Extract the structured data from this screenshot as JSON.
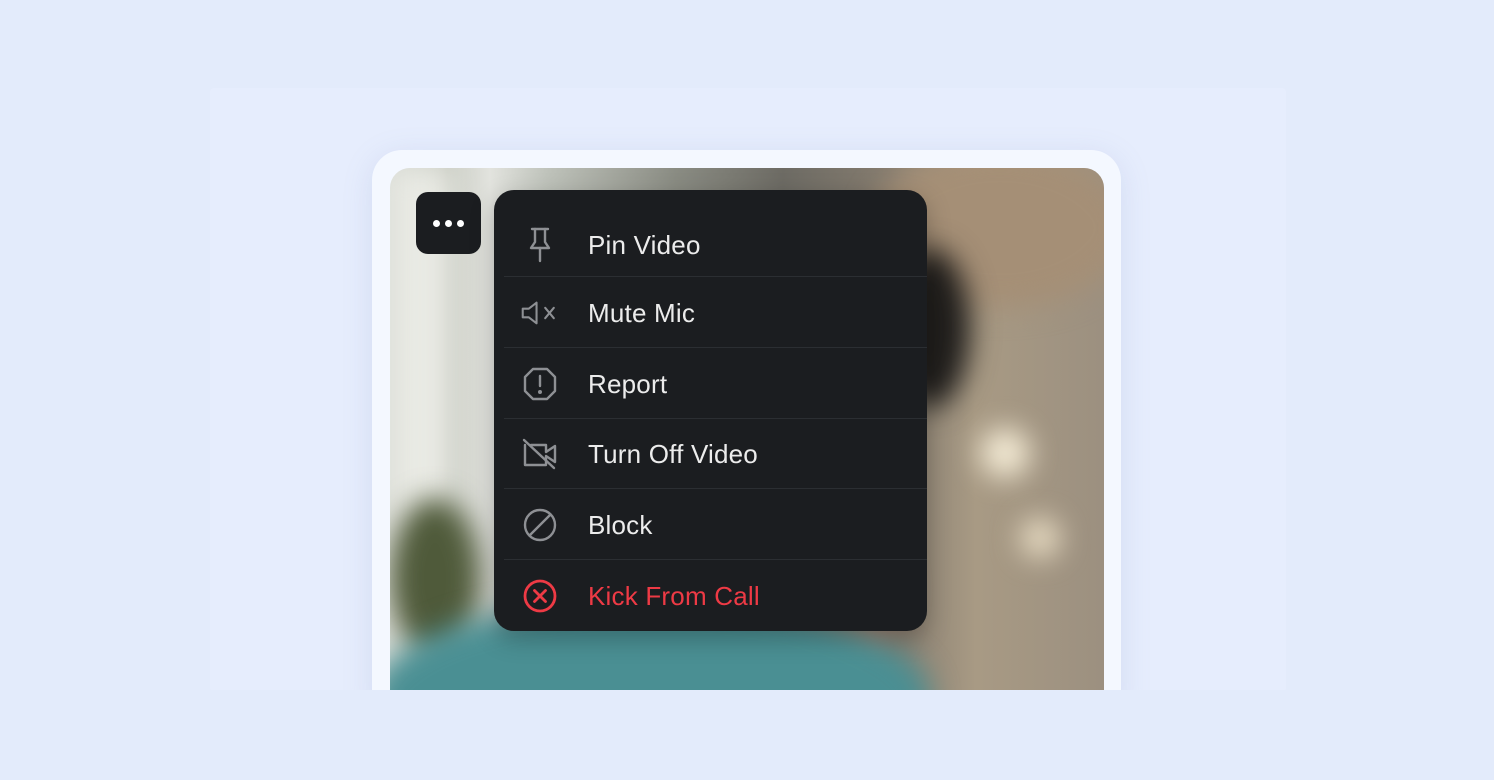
{
  "more_button": {
    "icon": "more-horizontal-icon"
  },
  "menu": {
    "items": [
      {
        "label": "Pin Video",
        "icon": "pin-icon",
        "danger": false
      },
      {
        "label": "Mute Mic",
        "icon": "speaker-mute-icon",
        "danger": false
      },
      {
        "label": "Report",
        "icon": "alert-circle-icon",
        "danger": false
      },
      {
        "label": "Turn Off Video",
        "icon": "video-off-icon",
        "danger": false
      },
      {
        "label": "Block",
        "icon": "block-icon",
        "danger": false
      },
      {
        "label": "Kick From Call",
        "icon": "close-circle-icon",
        "danger": true
      }
    ]
  },
  "colors": {
    "menu_background": "#1b1d20",
    "menu_text": "#ececec",
    "danger": "#ee3a45",
    "icon_gray": "#8e9094",
    "page_background": "#e3ebfb"
  }
}
